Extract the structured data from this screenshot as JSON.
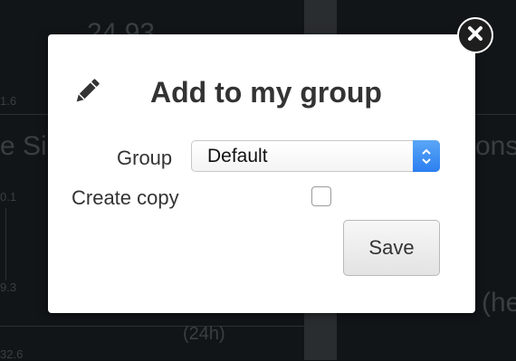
{
  "background": {
    "top_value": "24.93",
    "tick_1": "1.6",
    "partial_left": "e Si",
    "partial_right": "ons",
    "tick_2": "0.1",
    "tick_3": "9.3",
    "period": "(24h)",
    "partial_right_bottom": "(he",
    "tick_4": "32.6"
  },
  "dialog": {
    "title": "Add to my group",
    "group_label": "Group",
    "group_selected": "Default",
    "create_copy_label": "Create copy",
    "create_copy_checked": false,
    "save_label": "Save",
    "icons": {
      "title_icon": "pencil-icon",
      "close_icon": "close-icon",
      "select_icon": "updown-chevron-icon"
    }
  },
  "colors": {
    "overlay": "#121518",
    "select_accent": "#2b7ff0",
    "close_button": "#1e1e1e"
  }
}
